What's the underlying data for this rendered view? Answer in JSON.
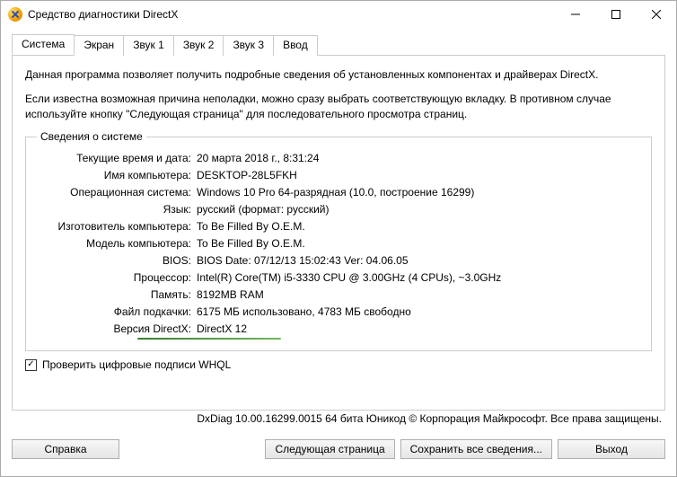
{
  "window": {
    "title": "Средство диагностики DirectX"
  },
  "tabs": {
    "system": "Система",
    "screen": "Экран",
    "sound1": "Звук 1",
    "sound2": "Звук 2",
    "sound3": "Звук 3",
    "input": "Ввод"
  },
  "intro": {
    "p1": "Данная программа позволяет получить подробные сведения об установленных компонентах и драйверах DirectX.",
    "p2": "Если известна возможная причина неполадки, можно сразу выбрать соответствующую вкладку. В противном случае используйте кнопку \"Следующая страница\" для последовательного просмотра страниц."
  },
  "sysinfo": {
    "legend": "Сведения о системе",
    "labels": {
      "datetime": "Текущие время и дата:",
      "computer": "Имя компьютера:",
      "os": "Операционная система:",
      "lang": "Язык:",
      "manufacturer": "Изготовитель компьютера:",
      "model": "Модель компьютера:",
      "bios": "BIOS:",
      "cpu": "Процессор:",
      "ram": "Память:",
      "pagefile": "Файл подкачки:",
      "dx": "Версия DirectX:"
    },
    "values": {
      "datetime": "20 марта 2018 г., 8:31:24",
      "computer": "DESKTOP-28L5FKH",
      "os": "Windows 10 Pro 64-разрядная (10.0, построение 16299)",
      "lang": "русский (формат: русский)",
      "manufacturer": "To Be Filled By O.E.M.",
      "model": "To Be Filled By O.E.M.",
      "bios": "BIOS Date: 07/12/13 15:02:43 Ver: 04.06.05",
      "cpu": "Intel(R) Core(TM) i5-3330 CPU @ 3.00GHz (4 CPUs), ~3.0GHz",
      "ram": "8192MB RAM",
      "pagefile": "6175 МБ использовано, 4783 МБ свободно",
      "dx": "DirectX 12"
    }
  },
  "checkbox": {
    "label": "Проверить цифровые подписи WHQL"
  },
  "footer": {
    "note": "DxDiag 10.00.16299.0015 64 бита Юникод © Корпорация Майкрософт. Все права защищены."
  },
  "buttons": {
    "help": "Справка",
    "next": "Следующая страница",
    "saveall": "Сохранить все сведения...",
    "exit": "Выход"
  }
}
